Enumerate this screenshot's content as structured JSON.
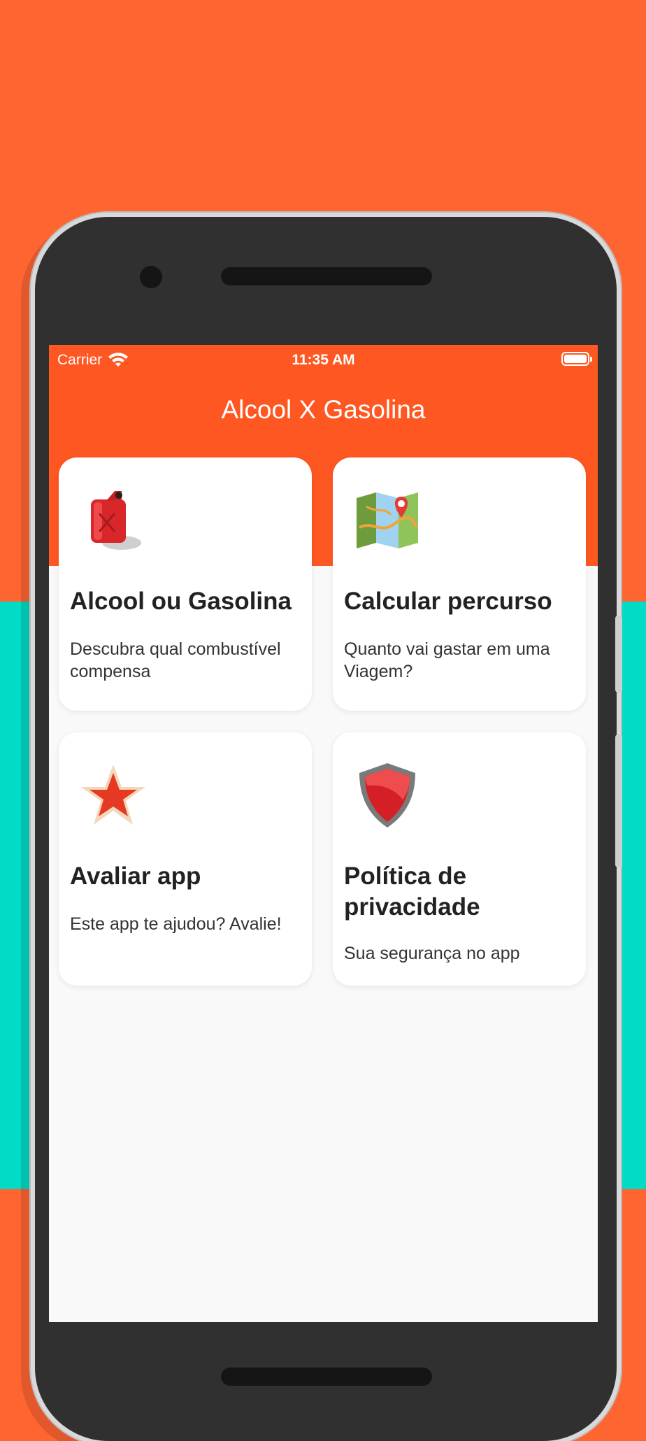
{
  "status_bar": {
    "carrier": "Carrier",
    "time": "11:35 AM"
  },
  "app": {
    "title": "Alcool X Gasolina"
  },
  "cards": [
    {
      "title": "Alcool ou Gasolina",
      "description": "Descubra qual combustível compensa",
      "icon": "fuel-can-icon"
    },
    {
      "title": "Calcular percurso",
      "description": "Quanto vai gastar em uma Viagem?",
      "icon": "map-pin-icon"
    },
    {
      "title": "Avaliar app",
      "description": "Este app te ajudou? Avalie!",
      "icon": "star-icon"
    },
    {
      "title": "Política de privacidade",
      "description": "Sua segurança no app",
      "icon": "shield-icon"
    }
  ],
  "colors": {
    "background_orange": "#ff6531",
    "background_teal": "#00dcc6",
    "app_bar": "#fe5722",
    "phone_body": "#303030"
  }
}
